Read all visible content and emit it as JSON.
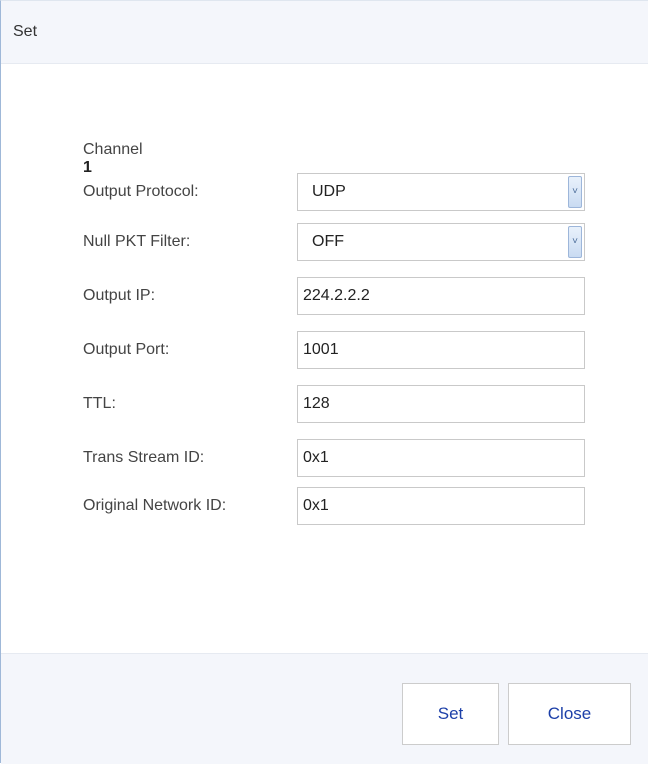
{
  "window": {
    "title": "Set"
  },
  "form": {
    "channel_label": "Channel",
    "channel_number": "1",
    "fields": [
      {
        "label": "Output Protocol:",
        "type": "select",
        "value": "UDP"
      },
      {
        "label": "Null PKT Filter:",
        "type": "select",
        "value": "OFF"
      },
      {
        "label": "Output IP:",
        "type": "text",
        "value": "224.2.2.2"
      },
      {
        "label": "Output Port:",
        "type": "text",
        "value": "1001"
      },
      {
        "label": "TTL:",
        "type": "text",
        "value": "128"
      },
      {
        "label": "Trans Stream ID:",
        "type": "text",
        "value": "0x1"
      },
      {
        "label": "Original Network ID:",
        "type": "text",
        "value": "0x1"
      }
    ]
  },
  "footer": {
    "set_label": "Set",
    "close_label": "Close"
  },
  "icons": {
    "select_arrow": "chevron-down-icon"
  },
  "colors": {
    "accent": "#1c3fa8",
    "header_bg": "#f4f6fb",
    "border": "#9fb8d8"
  }
}
